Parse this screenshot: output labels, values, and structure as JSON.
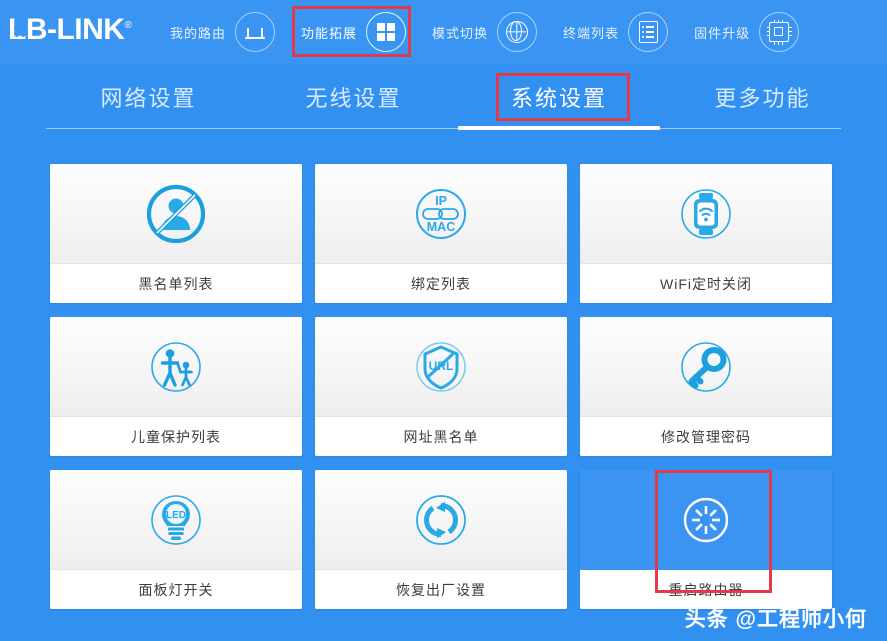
{
  "brand": {
    "logo_text": "LB-LINK",
    "registered_mark": "®"
  },
  "topnav": {
    "items": [
      {
        "label": "我的路由",
        "icon": "router-icon",
        "active": false
      },
      {
        "label": "功能拓展",
        "icon": "grid-icon",
        "active": true
      },
      {
        "label": "模式切换",
        "icon": "globe-icon",
        "active": false
      },
      {
        "label": "终端列表",
        "icon": "list-icon",
        "active": false
      },
      {
        "label": "固件升级",
        "icon": "chip-icon",
        "active": false
      }
    ]
  },
  "tabs": [
    {
      "label": "网络设置",
      "active": false
    },
    {
      "label": "无线设置",
      "active": false
    },
    {
      "label": "系统设置",
      "active": true
    },
    {
      "label": "更多功能",
      "active": false
    }
  ],
  "cards": [
    {
      "label": "黑名单列表",
      "icon": "blacklist-user-icon",
      "selected": false
    },
    {
      "label": "绑定列表",
      "icon": "ip-mac-bind-icon",
      "selected": false,
      "icon_text_top": "IP",
      "icon_text_bottom": "MAC"
    },
    {
      "label": "WiFi定时关闭",
      "icon": "wifi-timer-icon",
      "selected": false
    },
    {
      "label": "儿童保护列表",
      "icon": "parental-control-icon",
      "selected": false
    },
    {
      "label": "网址黑名单",
      "icon": "url-shield-icon",
      "selected": false,
      "icon_text": "URL"
    },
    {
      "label": "修改管理密码",
      "icon": "key-icon",
      "selected": false
    },
    {
      "label": "面板灯开关",
      "icon": "led-bulb-icon",
      "selected": false,
      "icon_text": "LED"
    },
    {
      "label": "恢复出厂设置",
      "icon": "factory-reset-icon",
      "selected": false
    },
    {
      "label": "重启路由器",
      "icon": "reboot-icon",
      "selected": true
    }
  ],
  "annotations": {
    "highlight_color": "#e03b4a",
    "boxes": [
      {
        "target": "功能拓展"
      },
      {
        "target": "系统设置"
      },
      {
        "target": "重启路由器"
      }
    ]
  },
  "watermark": "头条 @工程师小何",
  "colors": {
    "background": "#3291f0",
    "topbar": "#3a95f2",
    "card_bg": "#ffffff",
    "icon_blue": "#1a9fe0",
    "selected_card": "#3b93f2"
  }
}
